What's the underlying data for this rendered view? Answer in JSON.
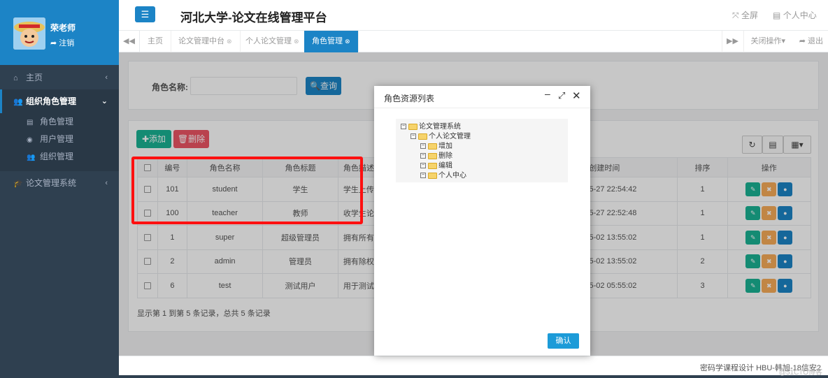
{
  "user": {
    "name": "荣老师",
    "logout": "注销"
  },
  "sidebar": {
    "items": [
      {
        "label": "主页",
        "icon": "home-icon"
      },
      {
        "label": "组织角色管理",
        "icon": "users-icon"
      },
      {
        "label": "论文管理系统",
        "icon": "graduation-cap-icon"
      }
    ],
    "sub": [
      {
        "label": "角色管理",
        "icon": "id-card-icon"
      },
      {
        "label": "用户管理",
        "icon": "user-circle-icon"
      },
      {
        "label": "组织管理",
        "icon": "group-icon"
      }
    ]
  },
  "header": {
    "title": "河北大学-论文在线管理平台",
    "fullscreen": "全屏",
    "personal": "个人中心"
  },
  "tabs": [
    {
      "label": "主页"
    },
    {
      "label": "论文管理中台"
    },
    {
      "label": "个人论文管理"
    },
    {
      "label": "角色管理"
    }
  ],
  "tabbar": {
    "close_ops": "关闭操作",
    "exit": "退出"
  },
  "search": {
    "label": "角色名称:",
    "value": "",
    "button": "查询"
  },
  "toolbar": {
    "add": "添加",
    "delete": "删除"
  },
  "table": {
    "columns": [
      "编号",
      "角色名称",
      "角色标题",
      "角色描述",
      "创建时间",
      "排序",
      "操作"
    ],
    "rows": [
      {
        "id": "101",
        "name": "student",
        "title": "学生",
        "desc": "学生上传论文",
        "created": "2021-05-27 22:54:42",
        "sort": "1"
      },
      {
        "id": "100",
        "name": "teacher",
        "title": "教师",
        "desc": "收学生论文",
        "created": "2021-05-27 22:52:48",
        "sort": "1"
      },
      {
        "id": "1",
        "name": "super",
        "title": "超级管理员",
        "desc": "拥有所有权限",
        "created": "2020-05-02 13:55:02",
        "sort": "1"
      },
      {
        "id": "2",
        "name": "admin",
        "title": "管理员",
        "desc": "拥有除权限管理系统",
        "created": "2020-05-02 13:55:02",
        "sort": "2"
      },
      {
        "id": "6",
        "name": "test",
        "title": "测试用户",
        "desc": "用于测试账号",
        "created": "2020-05-02 05:55:02",
        "sort": "3"
      }
    ]
  },
  "pager": "显示第 1 到第 5 条记录，总共 5 条记录",
  "dialog": {
    "title": "角色资源列表",
    "tree": [
      {
        "label": "论文管理系统",
        "depth": 0
      },
      {
        "label": "个人论文管理",
        "depth": 1
      },
      {
        "label": "增加",
        "depth": 2
      },
      {
        "label": "删除",
        "depth": 2
      },
      {
        "label": "编辑",
        "depth": 2
      },
      {
        "label": "个人中心",
        "depth": 2
      }
    ],
    "confirm": "确认"
  },
  "footer": "密码学课程设计 HBU-韩旭-18信安2",
  "watermark": "@51CTO博客",
  "colors": {
    "primary": "#1c84c6",
    "sidebar": "#2f4050",
    "green": "#1ab394",
    "red": "#ed5565",
    "orange": "#f8ac59",
    "highlight": "#ff1010"
  }
}
